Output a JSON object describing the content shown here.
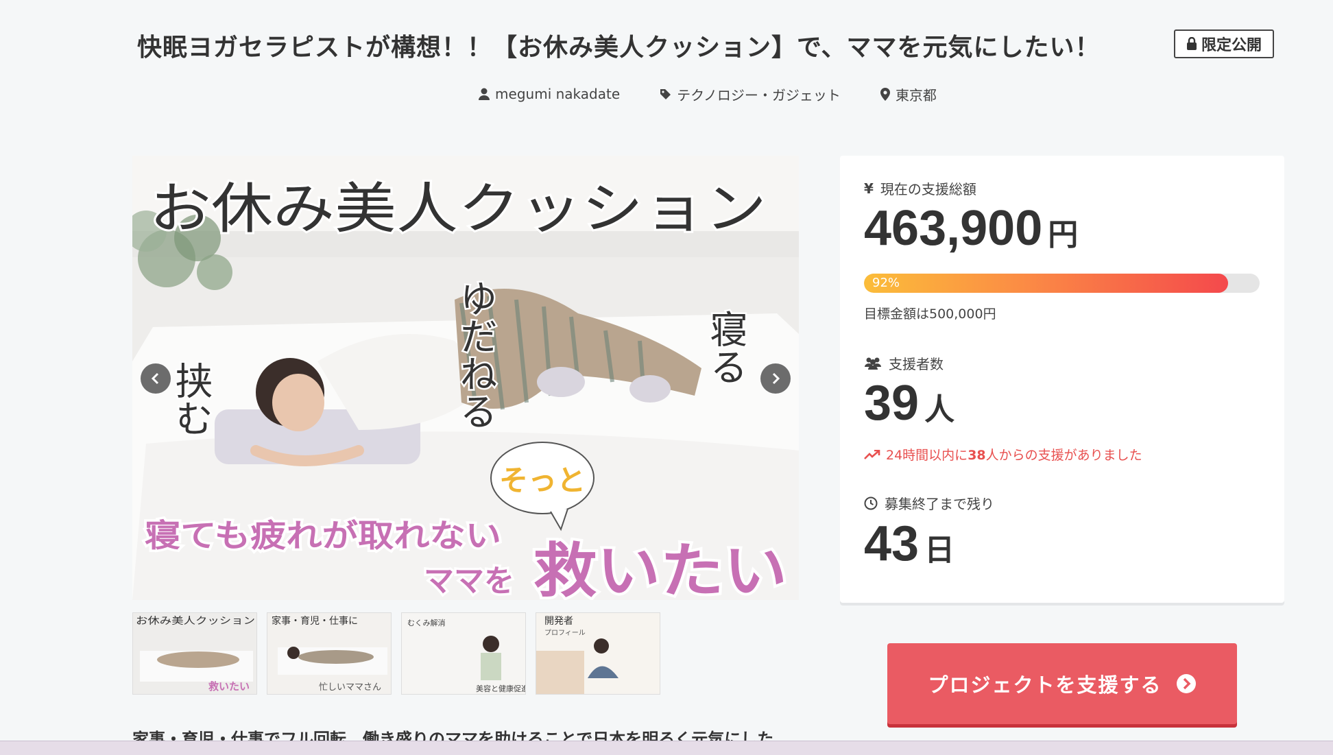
{
  "project": {
    "title": "快眠ヨガセラピストが構想！！【お休み美人クッション】で、ママを元気にしたい！",
    "badge": "限定公開",
    "owner": "megumi nakadate",
    "category": "テクノロジー・ガジェット",
    "location": "東京都"
  },
  "gallery": {
    "main_image": {
      "headline": "お休み美人クッション",
      "word_pinch": "挟む",
      "word_entrust": "ゆだねる",
      "word_sleep": "寝る",
      "bubble": "そっと",
      "line1": "寝ても疲れが取れない",
      "line2_a": "ママを",
      "line2_b": "救いたい"
    },
    "thumbnails": [
      {
        "caption_top": "お休み美人クッション",
        "caption_bottom": "救いたい"
      },
      {
        "caption_top": "家事・育児・仕事に",
        "caption_bottom": "忙しいママさん"
      },
      {
        "caption_top": "むくみ解消",
        "caption_bottom": "美容と健康促進"
      },
      {
        "caption_top": "開発者",
        "caption_bottom": "プロフィール"
      }
    ]
  },
  "stats": {
    "total_label": "現在の支援総額",
    "total_amount": "463,900",
    "total_unit": "円",
    "progress_percent": 92,
    "progress_label": "92%",
    "goal_text": "目標金額は500,000円",
    "backers_label": "支援者数",
    "backers_count": "39",
    "backers_unit": "人",
    "recent_prefix": "24時間以内に",
    "recent_count": "38",
    "recent_suffix": "人からの支援がありました",
    "remaining_label": "募集終了まで残り",
    "remaining_days": "43",
    "remaining_unit": "日"
  },
  "cta": {
    "support_label": "プロジェクトを支援する"
  },
  "description_heading": "家事・育児・仕事でフル回転　働き盛りのママを助けることで日本を明るく元気にした",
  "colors": {
    "accent_red": "#ea5b63",
    "progress_start": "#fbbd3a",
    "progress_end": "#f4494c",
    "recent_text": "#e8504f",
    "image_pink": "#c770b4"
  },
  "icons": [
    "lock-icon",
    "user-icon",
    "tag-icon",
    "map-pin-icon",
    "yen-icon",
    "users-icon",
    "trending-up-icon",
    "clock-icon",
    "chevron-left-icon",
    "chevron-right-icon",
    "arrow-circle-right-icon"
  ]
}
